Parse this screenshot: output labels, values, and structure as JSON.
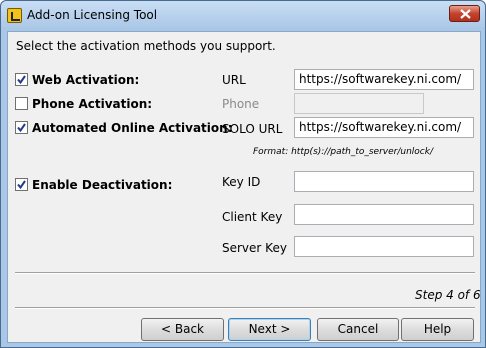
{
  "window": {
    "title": "Add-on Licensing Tool"
  },
  "instructions": "Select the activation methods you support.",
  "methods": [
    {
      "label": "Web Activation:",
      "checked": true,
      "field_label": "URL",
      "field_value": "https://softwarekey.ni.com/",
      "enabled": true
    },
    {
      "label": "Phone Activation:",
      "checked": false,
      "field_label": "Phone",
      "field_value": "",
      "enabled": false
    },
    {
      "label": "Automated Online Activation:",
      "checked": true,
      "field_label": "SOLO URL",
      "field_value": "https://softwarekey.ni.com/",
      "enabled": true
    }
  ],
  "format_hint": "Format: http(s)://path_to_server/unlock/",
  "deactivation": {
    "label": "Enable Deactivation:",
    "checked": true,
    "fields": [
      {
        "label": "Key ID",
        "value": ""
      },
      {
        "label": "Client Key",
        "value": ""
      },
      {
        "label": "Server Key",
        "value": ""
      }
    ]
  },
  "step_text": "Step 4 of 6",
  "buttons": {
    "back": "< Back",
    "next": "Next >",
    "cancel": "Cancel",
    "help": "Help"
  },
  "colors": {
    "checkmark": "#1e3a8a",
    "titlebar": "#a8c6e6",
    "close": "#c6432c"
  }
}
